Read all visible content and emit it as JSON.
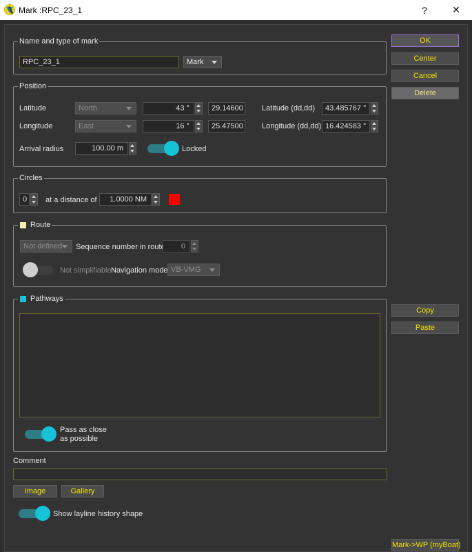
{
  "window": {
    "title": "Mark :RPC_23_1",
    "help_label": "?",
    "close_label": "✕"
  },
  "name_group": {
    "title": "Name and type of mark",
    "name_value": "RPC_23_1",
    "type_value": "Mark"
  },
  "position": {
    "title": "Position",
    "latitude_label": "Latitude",
    "latitude_hemisphere": "North",
    "latitude_degrees": "43 °",
    "latitude_minutes": "29.14600 '",
    "latitude_dd_label": "Latitude (dd,dd)",
    "latitude_dd_value": "43.485767 °",
    "longitude_label": "Longitude",
    "longitude_hemisphere": "East",
    "longitude_degrees": "16 °",
    "longitude_minutes": "25.47500 '",
    "longitude_dd_label": "Longitude (dd,dd)",
    "longitude_dd_value": "16.424583 °",
    "arrival_radius_label": "Arrival radius",
    "arrival_radius_value": "100.00 m",
    "locked_label": "Locked"
  },
  "circles": {
    "title": "Circles",
    "count_value": "0",
    "distance_label": "at a distance of",
    "distance_value": "1.0000 NM",
    "color": "#ff0000"
  },
  "route": {
    "title": "Route",
    "checkbox_color": "#f5f2b0",
    "route_value": "Not defined",
    "sequence_label": "Sequence number in route",
    "sequence_value": "0",
    "simplifiable_label": "Not simplifiable",
    "nav_mode_label": "Navigation mode",
    "nav_mode_value": "VB-VMG"
  },
  "pathways": {
    "title": "Pathways",
    "checkbox_color": "#17c1d6",
    "pass_close_line1": "Pass as close",
    "pass_close_line2": "as possible"
  },
  "comment": {
    "label": "Comment",
    "value": ""
  },
  "buttons": {
    "ok": "OK",
    "center": "Center",
    "cancel": "Cancel",
    "delete": "Delete",
    "copy": "Copy",
    "paste": "Paste",
    "image": "Image",
    "gallery": "Gallery",
    "mark_to_wp": "Mark->WP (myBoat)"
  },
  "layline": {
    "label": "Show layline history shape"
  },
  "colors": {
    "accent_toggle": "#17c1d6",
    "button_text": "#f2e400",
    "background": "#333333"
  }
}
